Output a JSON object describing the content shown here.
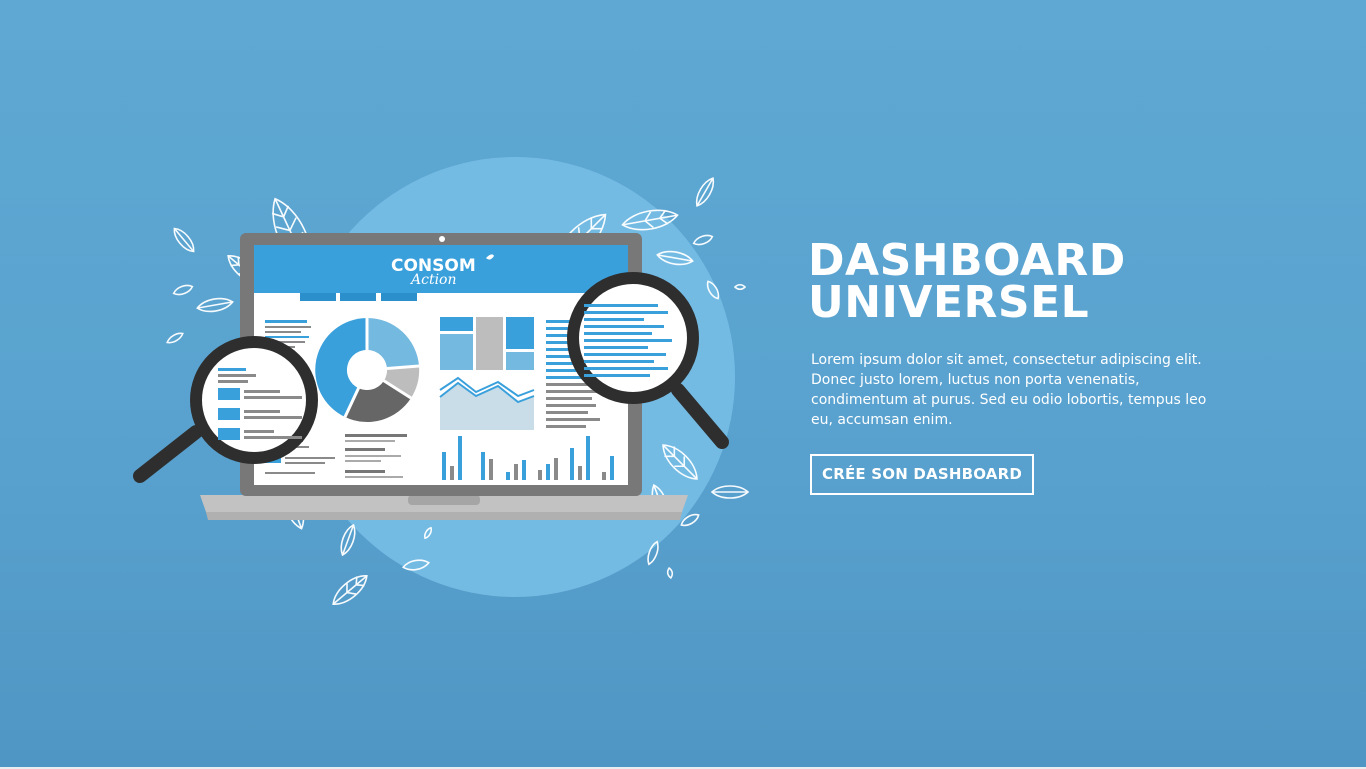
{
  "hero": {
    "title_line1": "DASHBOARD",
    "title_line2": "UNIVERSEL",
    "description": "Lorem ipsum dolor sit amet, consectetur adipiscing elit. Donec justo lorem, luctus non porta venenatis, condimentum at purus. Sed eu odio lobortis, tempus leo eu, accumsan enim.",
    "cta_label": "CRÉE SON DASHBOARD"
  },
  "illustration": {
    "logo_line1": "CONSOM",
    "logo_line2": "Action"
  },
  "colors": {
    "background": "#5aa3d0",
    "circle": "#74bbe4",
    "accent": "#3aa0dc",
    "dark": "#2e2e2e",
    "screen": "#ffffff"
  }
}
